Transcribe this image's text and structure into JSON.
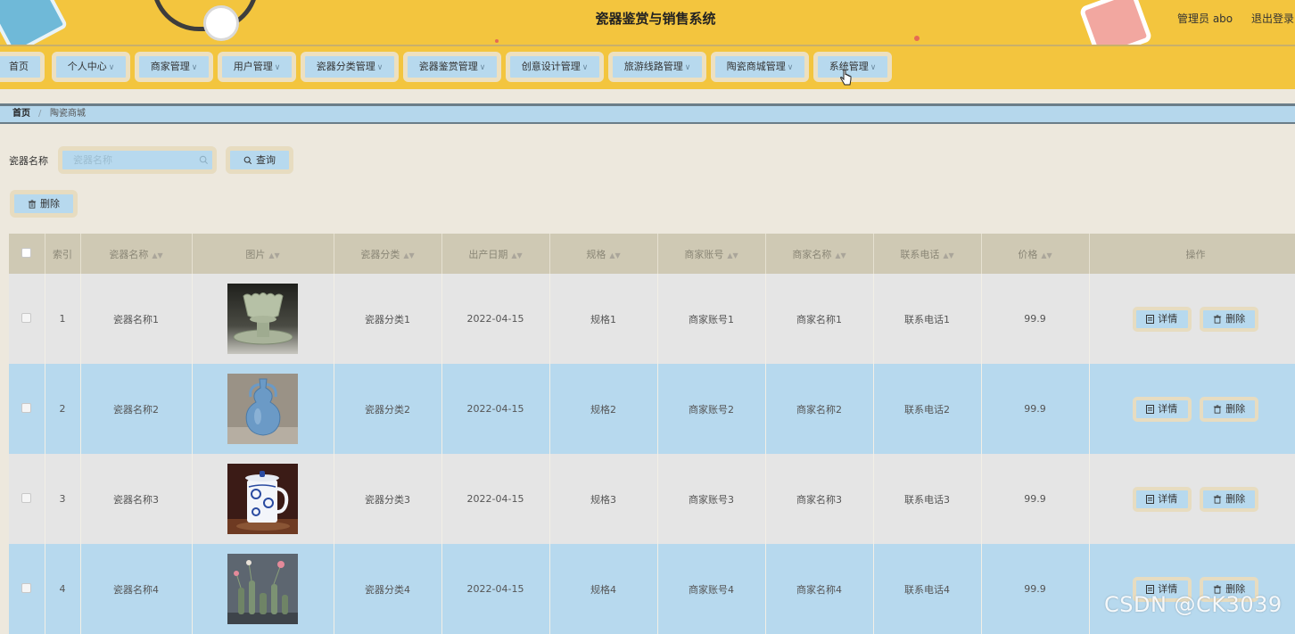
{
  "header": {
    "title": "瓷器鉴赏与销售系统",
    "admin": "管理员 abo",
    "logout": "退出登录"
  },
  "nav": {
    "items": [
      {
        "label": "首页",
        "dropdown": false
      },
      {
        "label": "个人中心",
        "dropdown": true
      },
      {
        "label": "商家管理",
        "dropdown": true
      },
      {
        "label": "用户管理",
        "dropdown": true
      },
      {
        "label": "瓷器分类管理",
        "dropdown": true
      },
      {
        "label": "瓷器鉴赏管理",
        "dropdown": true
      },
      {
        "label": "创意设计管理",
        "dropdown": true
      },
      {
        "label": "旅游线路管理",
        "dropdown": true
      },
      {
        "label": "陶瓷商城管理",
        "dropdown": true
      },
      {
        "label": "系统管理",
        "dropdown": true
      }
    ]
  },
  "breadcrumb": {
    "home": "首页",
    "separator": "/",
    "current": "陶瓷商城"
  },
  "search": {
    "label": "瓷器名称",
    "placeholder": "瓷器名称",
    "query_label": "查询",
    "delete_label": "删除"
  },
  "table": {
    "columns": [
      "索引",
      "瓷器名称",
      "图片",
      "瓷器分类",
      "出产日期",
      "规格",
      "商家账号",
      "商家名称",
      "联系电话",
      "价格",
      "操作"
    ],
    "rows": [
      {
        "index": "1",
        "name": "瓷器名称1",
        "image": "celadon-cup-on-stand",
        "category": "瓷器分类1",
        "date": "2022-04-15",
        "spec": "规格1",
        "account": "商家账号1",
        "merchant": "商家名称1",
        "phone": "联系电话1",
        "price": "99.9"
      },
      {
        "index": "2",
        "name": "瓷器名称2",
        "image": "blue-gourd-vase",
        "category": "瓷器分类2",
        "date": "2022-04-15",
        "spec": "规格2",
        "account": "商家账号2",
        "merchant": "商家名称2",
        "phone": "联系电话2",
        "price": "99.9"
      },
      {
        "index": "3",
        "name": "瓷器名称3",
        "image": "blue-white-lidded-mug",
        "category": "瓷器分类3",
        "date": "2022-04-15",
        "spec": "规格3",
        "account": "商家账号3",
        "merchant": "商家名称3",
        "phone": "联系电话3",
        "price": "99.9"
      },
      {
        "index": "4",
        "name": "瓷器名称4",
        "image": "green-vases-with-flowers",
        "category": "瓷器分类4",
        "date": "2022-04-15",
        "spec": "规格4",
        "account": "商家账号4",
        "merchant": "商家名称4",
        "phone": "联系电话4",
        "price": "99.9"
      }
    ],
    "detail_label": "详情",
    "delete_label": "删除"
  },
  "watermark": "CSDN @CK3039",
  "colors": {
    "header_bg": "#f3c53e",
    "button_bg": "#b7d9ee",
    "button_border": "#e7dcc0",
    "row_gray": "#e5e5e5",
    "row_blue": "#b7d9ee",
    "table_head": "#cfc9b4",
    "page_bg": "#ede8dd"
  }
}
